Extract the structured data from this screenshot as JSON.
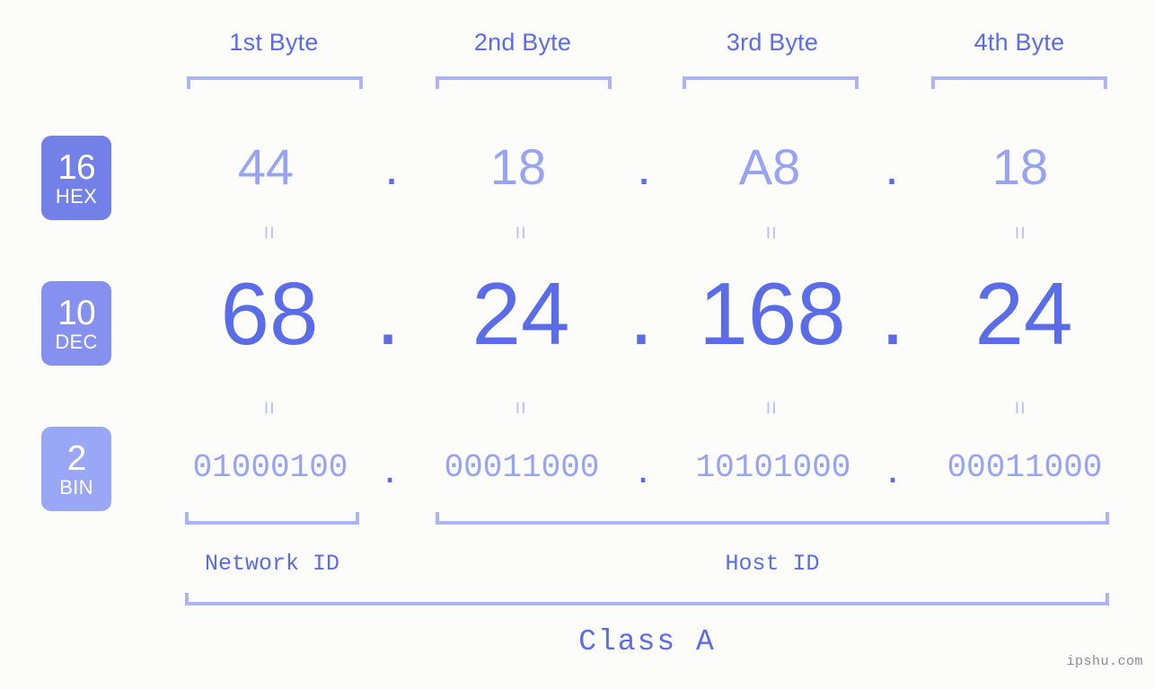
{
  "background_color": "#fcfdfa",
  "accent_color": "#5a6ce8",
  "accent_light_color": "#98a3f2",
  "bracket_color": "#aab4f7",
  "headers": {
    "byte1": "1st Byte",
    "byte2": "2nd Byte",
    "byte3": "3rd Byte",
    "byte4": "4th Byte"
  },
  "bases": [
    {
      "number": "16",
      "name": "HEX",
      "color": "#7380e8"
    },
    {
      "number": "10",
      "name": "DEC",
      "color": "#8590ef"
    },
    {
      "number": "2",
      "name": "BIN",
      "color": "#9aa6f6"
    }
  ],
  "separator": {
    "dot": ".",
    "equals": "="
  },
  "rows": {
    "hex": {
      "b1": "44",
      "b2": "18",
      "b3": "A8",
      "b4": "18"
    },
    "dec": {
      "b1": "68",
      "b2": "24",
      "b3": "168",
      "b4": "24"
    },
    "bin": {
      "b1": "01000100",
      "b2": "00011000",
      "b3": "10101000",
      "b4": "00011000"
    }
  },
  "sections": {
    "network_id": "Network ID",
    "host_id": "Host ID",
    "class": "Class A"
  },
  "watermark": "ipshu.com"
}
